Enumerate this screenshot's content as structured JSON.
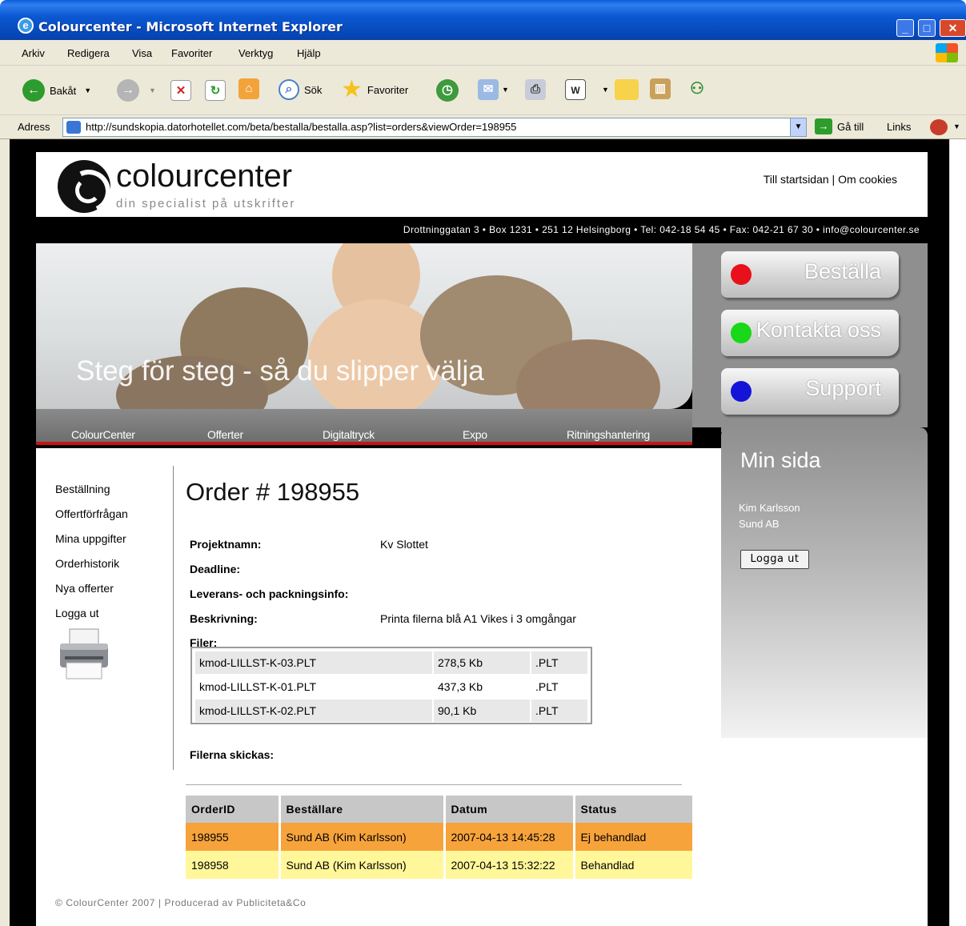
{
  "window": {
    "title": "Colourcenter - Microsoft Internet Explorer"
  },
  "menu": [
    "Arkiv",
    "Redigera",
    "Visa",
    "Favoriter",
    "Verktyg",
    "Hjälp"
  ],
  "toolbar": {
    "back": "Bakåt",
    "search": "Sök",
    "favorites": "Favoriter"
  },
  "address": {
    "label": "Adress",
    "url": "http://sundskopia.datorhotellet.com/beta/bestalla/bestalla.asp?list=orders&viewOrder=198955",
    "go": "Gå till",
    "links": "Links"
  },
  "site": {
    "logo_name": "colourcenter",
    "logo_tagline": "din specialist på utskrifter",
    "header_links": "Till startsidan | Om cookies",
    "contact": "Drottninggatan 3 • Box 1231 • 251 12 Helsingborg • Tel: 042-18 54 45 • Fax: 042-21 67 30 • info@colourcenter.se",
    "banner_text": "Steg för steg - så du slipper välja",
    "side_buttons": [
      {
        "label": "Beställa",
        "color": "#e8101a"
      },
      {
        "label": "Kontakta oss",
        "color": "#18d818"
      },
      {
        "label": "Support",
        "color": "#1414d8"
      }
    ],
    "nav": [
      "ColourCenter",
      "Offerter",
      "Digitaltryck",
      "Expo",
      "Ritningshantering"
    ],
    "min_sida": {
      "heading": "Min sida",
      "user_name": "Kim Karlsson",
      "company": "Sund AB",
      "logout": "Logga ut"
    },
    "left_nav": [
      "Beställning",
      "Offertförfrågan",
      "Mina uppgifter",
      "Orderhistorik",
      "Nya offerter",
      "Logga ut"
    ],
    "footer": "© ColourCenter 2007 | Producerad av Publiciteta&Co"
  },
  "order": {
    "title": "Order # 198955",
    "fields": [
      {
        "label": "Projektnamn:",
        "value": "Kv Slottet"
      },
      {
        "label": "Deadline:",
        "value": ""
      },
      {
        "label": "Leverans- och packningsinfo:",
        "value": ""
      },
      {
        "label": "Beskrivning:",
        "value": "Printa filerna blå A1 Vikes i 3 omgångar"
      },
      {
        "label": "Filer:",
        "value": ""
      }
    ],
    "files": [
      {
        "name": "kmod-LILLST-K-03.PLT",
        "size": "278,5 Kb",
        "type": ".PLT"
      },
      {
        "name": "kmod-LILLST-K-01.PLT",
        "size": "437,3 Kb",
        "type": ".PLT"
      },
      {
        "name": "kmod-LILLST-K-02.PLT",
        "size": "90,1 Kb",
        "type": ".PLT"
      }
    ],
    "send_label": "Filerna skickas:"
  },
  "orders_table": {
    "headers": [
      "OrderID",
      "Beställare",
      "Datum",
      "Status"
    ],
    "rows": [
      {
        "id": "198955",
        "customer": "Sund AB (Kim Karlsson)",
        "date": "2007-04-13 14:45:28",
        "status": "Ej behandlad"
      },
      {
        "id": "198958",
        "customer": "Sund AB (Kim Karlsson)",
        "date": "2007-04-13 15:32:22",
        "status": "Behandlad"
      }
    ]
  }
}
